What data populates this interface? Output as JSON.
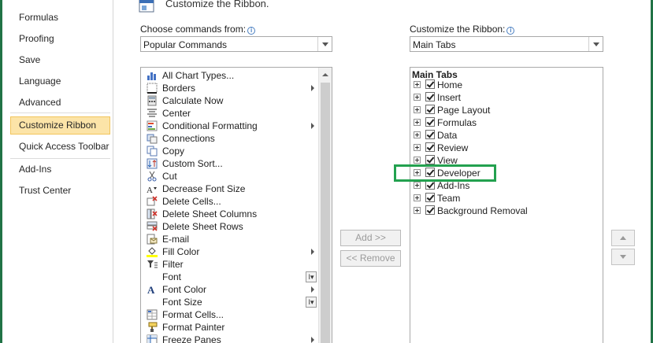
{
  "sidebar": {
    "items": [
      {
        "label": "Formulas"
      },
      {
        "label": "Proofing"
      },
      {
        "label": "Save"
      },
      {
        "label": "Language"
      },
      {
        "label": "Advanced"
      },
      {
        "label": "Customize Ribbon",
        "selected": true
      },
      {
        "label": "Quick Access Toolbar"
      },
      {
        "label": "Add-Ins"
      },
      {
        "label": "Trust Center"
      }
    ]
  },
  "header": {
    "title": "Customize the Ribbon."
  },
  "left_panel": {
    "label": "Choose commands from:",
    "info_glyph": "i",
    "selected": "Popular Commands",
    "commands": [
      {
        "label": "All Chart Types...",
        "icon": "chart-icon"
      },
      {
        "label": "Borders",
        "icon": "borders-icon",
        "submenu": true
      },
      {
        "label": "Calculate Now",
        "icon": "calculator-icon"
      },
      {
        "label": "Center",
        "icon": "align-center-icon"
      },
      {
        "label": "Conditional Formatting",
        "icon": "conditional-formatting-icon",
        "submenu": true
      },
      {
        "label": "Connections",
        "icon": "connections-icon"
      },
      {
        "label": "Copy",
        "icon": "copy-icon"
      },
      {
        "label": "Custom Sort...",
        "icon": "sort-icon"
      },
      {
        "label": "Cut",
        "icon": "scissors-icon"
      },
      {
        "label": "Decrease Font Size",
        "icon": "decrease-font-icon"
      },
      {
        "label": "Delete Cells...",
        "icon": "delete-cells-icon"
      },
      {
        "label": "Delete Sheet Columns",
        "icon": "delete-columns-icon"
      },
      {
        "label": "Delete Sheet Rows",
        "icon": "delete-rows-icon"
      },
      {
        "label": "E-mail",
        "icon": "email-icon"
      },
      {
        "label": "Fill Color",
        "icon": "fill-color-icon",
        "submenu": true
      },
      {
        "label": "Filter",
        "icon": "filter-icon"
      },
      {
        "label": "Font",
        "icon": "font-icon",
        "split": true
      },
      {
        "label": "Font Color",
        "icon": "font-color-icon",
        "submenu": true
      },
      {
        "label": "Font Size",
        "icon": "font-size-icon",
        "split": true
      },
      {
        "label": "Format Cells...",
        "icon": "format-cells-icon"
      },
      {
        "label": "Format Painter",
        "icon": "format-painter-icon"
      },
      {
        "label": "Freeze Panes",
        "icon": "freeze-panes-icon",
        "submenu": true
      }
    ]
  },
  "right_panel": {
    "label": "Customize the Ribbon:",
    "info_glyph": "i",
    "selected": "Main Tabs",
    "tree_header": "Main Tabs",
    "tabs": [
      {
        "label": "Home"
      },
      {
        "label": "Insert"
      },
      {
        "label": "Page Layout"
      },
      {
        "label": "Formulas"
      },
      {
        "label": "Data"
      },
      {
        "label": "Review"
      },
      {
        "label": "View"
      },
      {
        "label": "Developer",
        "highlighted": true
      },
      {
        "label": "Add-Ins"
      },
      {
        "label": "Team"
      },
      {
        "label": "Background Removal"
      }
    ]
  },
  "buttons": {
    "add": "Add >>",
    "remove": "<< Remove"
  },
  "colors": {
    "accent": "#217346",
    "highlight": "#23a14f",
    "selected_bg": "#fce4a8"
  }
}
